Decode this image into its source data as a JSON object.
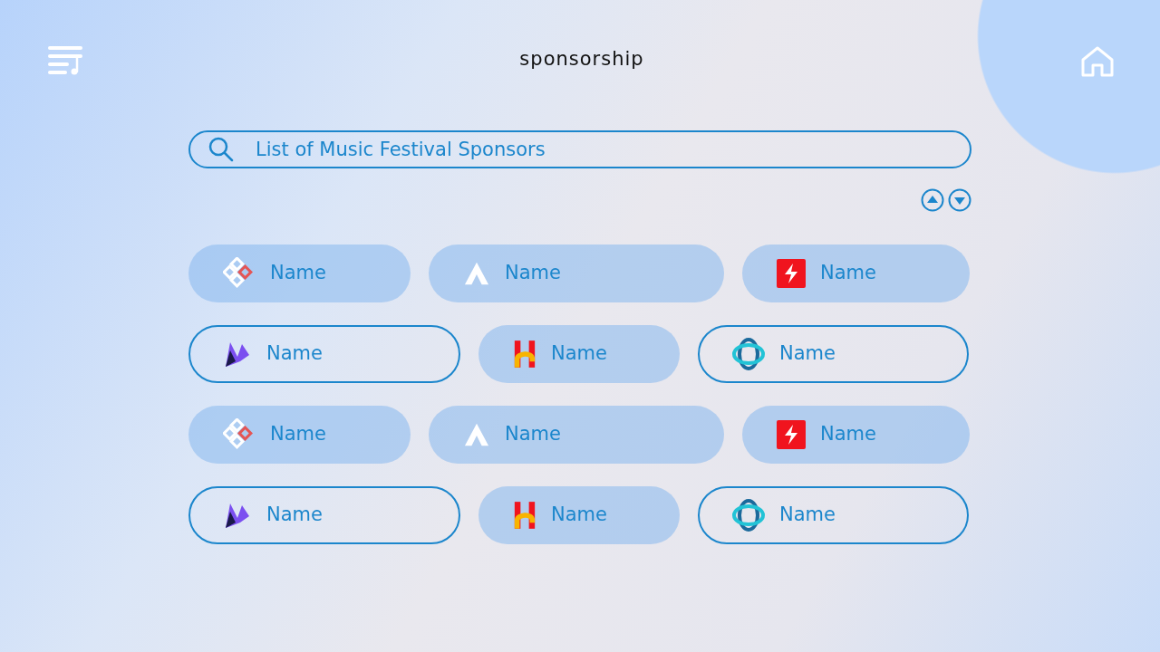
{
  "header": {
    "title": "sponsorship"
  },
  "search": {
    "value": "List of Music Festival Sponsors"
  },
  "sponsor_rows": [
    {
      "items": [
        {
          "name": "Name"
        },
        {
          "name": "Name"
        },
        {
          "name": "Name"
        }
      ]
    },
    {
      "items": [
        {
          "name": "Name"
        },
        {
          "name": "Name"
        },
        {
          "name": "Name"
        }
      ]
    },
    {
      "items": [
        {
          "name": "Name"
        },
        {
          "name": "Name"
        },
        {
          "name": "Name"
        }
      ]
    },
    {
      "items": [
        {
          "name": "Name"
        },
        {
          "name": "Name"
        },
        {
          "name": "Name"
        }
      ]
    }
  ]
}
